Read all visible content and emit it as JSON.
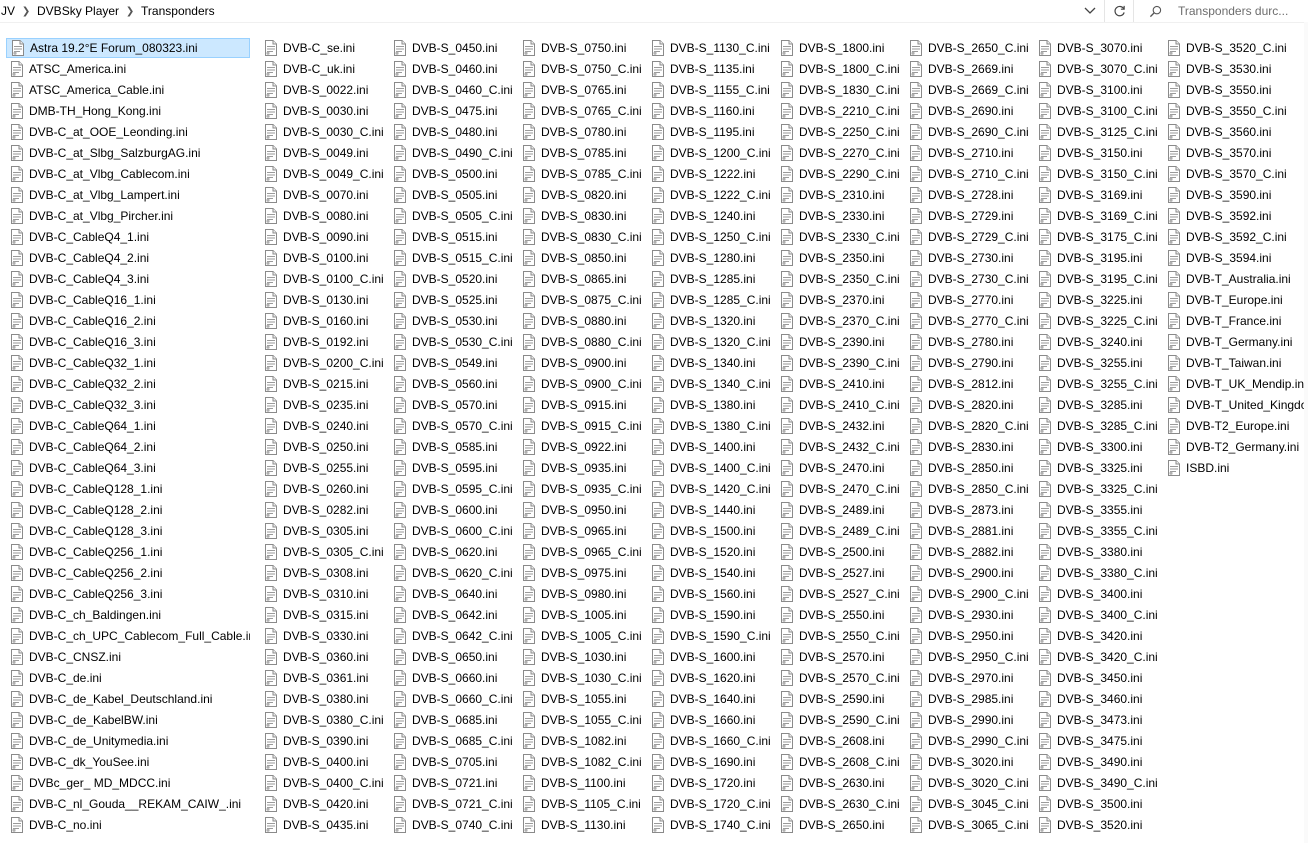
{
  "breadcrumb": {
    "items": [
      "JV",
      "DVBSky Player",
      "Transponders"
    ]
  },
  "search": {
    "placeholder": "Transponders durc..."
  },
  "colors": {
    "selection_bg": "#cce8ff",
    "selection_border": "#99d1ff"
  },
  "selected_file": "Astra 19.2°E Forum_080323.ini",
  "files": [
    [
      "Astra 19.2°E Forum_080323.ini",
      "ATSC_America.ini",
      "ATSC_America_Cable.ini",
      "DMB-TH_Hong_Kong.ini",
      "DVB-C_at_OOE_Leonding.ini",
      "DVB-C_at_Slbg_SalzburgAG.ini",
      "DVB-C_at_Vlbg_Cablecom.ini",
      "DVB-C_at_Vlbg_Lampert.ini",
      "DVB-C_at_Vlbg_Pircher.ini",
      "DVB-C_CableQ4_1.ini",
      "DVB-C_CableQ4_2.ini",
      "DVB-C_CableQ4_3.ini",
      "DVB-C_CableQ16_1.ini",
      "DVB-C_CableQ16_2.ini",
      "DVB-C_CableQ16_3.ini",
      "DVB-C_CableQ32_1.ini",
      "DVB-C_CableQ32_2.ini",
      "DVB-C_CableQ32_3.ini",
      "DVB-C_CableQ64_1.ini",
      "DVB-C_CableQ64_2.ini",
      "DVB-C_CableQ64_3.ini",
      "DVB-C_CableQ128_1.ini",
      "DVB-C_CableQ128_2.ini",
      "DVB-C_CableQ128_3.ini",
      "DVB-C_CableQ256_1.ini",
      "DVB-C_CableQ256_2.ini",
      "DVB-C_CableQ256_3.ini",
      "DVB-C_ch_Baldingen.ini",
      "DVB-C_ch_UPC_Cablecom_Full_Cable.ini",
      "DVB-C_CNSZ.ini",
      "DVB-C_de.ini",
      "DVB-C_de_Kabel_Deutschland.ini",
      "DVB-C_de_KabelBW.ini",
      "DVB-C_de_Unitymedia.ini",
      "DVB-C_dk_YouSee.ini",
      "DVBc_ger_ MD_MDCC.ini",
      "DVB-C_nl_Gouda__REKAM_CAIW_.ini",
      "DVB-C_no.ini"
    ],
    [
      "DVB-C_se.ini",
      "DVB-C_uk.ini",
      "DVB-S_0022.ini",
      "DVB-S_0030.ini",
      "DVB-S_0030_C.ini",
      "DVB-S_0049.ini",
      "DVB-S_0049_C.ini",
      "DVB-S_0070.ini",
      "DVB-S_0080.ini",
      "DVB-S_0090.ini",
      "DVB-S_0100.ini",
      "DVB-S_0100_C.ini",
      "DVB-S_0130.ini",
      "DVB-S_0160.ini",
      "DVB-S_0192.ini",
      "DVB-S_0200_C.ini",
      "DVB-S_0215.ini",
      "DVB-S_0235.ini",
      "DVB-S_0240.ini",
      "DVB-S_0250.ini",
      "DVB-S_0255.ini",
      "DVB-S_0260.ini",
      "DVB-S_0282.ini",
      "DVB-S_0305.ini",
      "DVB-S_0305_C.ini",
      "DVB-S_0308.ini",
      "DVB-S_0310.ini",
      "DVB-S_0315.ini",
      "DVB-S_0330.ini",
      "DVB-S_0360.ini",
      "DVB-S_0361.ini",
      "DVB-S_0380.ini",
      "DVB-S_0380_C.ini",
      "DVB-S_0390.ini",
      "DVB-S_0400.ini",
      "DVB-S_0400_C.ini",
      "DVB-S_0420.ini",
      "DVB-S_0435.ini"
    ],
    [
      "DVB-S_0450.ini",
      "DVB-S_0460.ini",
      "DVB-S_0460_C.ini",
      "DVB-S_0475.ini",
      "DVB-S_0480.ini",
      "DVB-S_0490_C.ini",
      "DVB-S_0500.ini",
      "DVB-S_0505.ini",
      "DVB-S_0505_C.ini",
      "DVB-S_0515.ini",
      "DVB-S_0515_C.ini",
      "DVB-S_0520.ini",
      "DVB-S_0525.ini",
      "DVB-S_0530.ini",
      "DVB-S_0530_C.ini",
      "DVB-S_0549.ini",
      "DVB-S_0560.ini",
      "DVB-S_0570.ini",
      "DVB-S_0570_C.ini",
      "DVB-S_0585.ini",
      "DVB-S_0595.ini",
      "DVB-S_0595_C.ini",
      "DVB-S_0600.ini",
      "DVB-S_0600_C.ini",
      "DVB-S_0620.ini",
      "DVB-S_0620_C.ini",
      "DVB-S_0640.ini",
      "DVB-S_0642.ini",
      "DVB-S_0642_C.ini",
      "DVB-S_0650.ini",
      "DVB-S_0660.ini",
      "DVB-S_0660_C.ini",
      "DVB-S_0685.ini",
      "DVB-S_0685_C.ini",
      "DVB-S_0705.ini",
      "DVB-S_0721.ini",
      "DVB-S_0721_C.ini",
      "DVB-S_0740_C.ini"
    ],
    [
      "DVB-S_0750.ini",
      "DVB-S_0750_C.ini",
      "DVB-S_0765.ini",
      "DVB-S_0765_C.ini",
      "DVB-S_0780.ini",
      "DVB-S_0785.ini",
      "DVB-S_0785_C.ini",
      "DVB-S_0820.ini",
      "DVB-S_0830.ini",
      "DVB-S_0830_C.ini",
      "DVB-S_0850.ini",
      "DVB-S_0865.ini",
      "DVB-S_0875_C.ini",
      "DVB-S_0880.ini",
      "DVB-S_0880_C.ini",
      "DVB-S_0900.ini",
      "DVB-S_0900_C.ini",
      "DVB-S_0915.ini",
      "DVB-S_0915_C.ini",
      "DVB-S_0922.ini",
      "DVB-S_0935.ini",
      "DVB-S_0935_C.ini",
      "DVB-S_0950.ini",
      "DVB-S_0965.ini",
      "DVB-S_0965_C.ini",
      "DVB-S_0975.ini",
      "DVB-S_0980.ini",
      "DVB-S_1005.ini",
      "DVB-S_1005_C.ini",
      "DVB-S_1030.ini",
      "DVB-S_1030_C.ini",
      "DVB-S_1055.ini",
      "DVB-S_1055_C.ini",
      "DVB-S_1082.ini",
      "DVB-S_1082_C.ini",
      "DVB-S_1100.ini",
      "DVB-S_1105_C.ini",
      "DVB-S_1130.ini"
    ],
    [
      "DVB-S_1130_C.ini",
      "DVB-S_1135.ini",
      "DVB-S_1155_C.ini",
      "DVB-S_1160.ini",
      "DVB-S_1195.ini",
      "DVB-S_1200_C.ini",
      "DVB-S_1222.ini",
      "DVB-S_1222_C.ini",
      "DVB-S_1240.ini",
      "DVB-S_1250_C.ini",
      "DVB-S_1280.ini",
      "DVB-S_1285.ini",
      "DVB-S_1285_C.ini",
      "DVB-S_1320.ini",
      "DVB-S_1320_C.ini",
      "DVB-S_1340.ini",
      "DVB-S_1340_C.ini",
      "DVB-S_1380.ini",
      "DVB-S_1380_C.ini",
      "DVB-S_1400.ini",
      "DVB-S_1400_C.ini",
      "DVB-S_1420_C.ini",
      "DVB-S_1440.ini",
      "DVB-S_1500.ini",
      "DVB-S_1520.ini",
      "DVB-S_1540.ini",
      "DVB-S_1560.ini",
      "DVB-S_1590.ini",
      "DVB-S_1590_C.ini",
      "DVB-S_1600.ini",
      "DVB-S_1620.ini",
      "DVB-S_1640.ini",
      "DVB-S_1660.ini",
      "DVB-S_1660_C.ini",
      "DVB-S_1690.ini",
      "DVB-S_1720.ini",
      "DVB-S_1720_C.ini",
      "DVB-S_1740_C.ini"
    ],
    [
      "DVB-S_1800.ini",
      "DVB-S_1800_C.ini",
      "DVB-S_1830_C.ini",
      "DVB-S_2210_C.ini",
      "DVB-S_2250_C.ini",
      "DVB-S_2270_C.ini",
      "DVB-S_2290_C.ini",
      "DVB-S_2310.ini",
      "DVB-S_2330.ini",
      "DVB-S_2330_C.ini",
      "DVB-S_2350.ini",
      "DVB-S_2350_C.ini",
      "DVB-S_2370.ini",
      "DVB-S_2370_C.ini",
      "DVB-S_2390.ini",
      "DVB-S_2390_C.ini",
      "DVB-S_2410.ini",
      "DVB-S_2410_C.ini",
      "DVB-S_2432.ini",
      "DVB-S_2432_C.ini",
      "DVB-S_2470.ini",
      "DVB-S_2470_C.ini",
      "DVB-S_2489.ini",
      "DVB-S_2489_C.ini",
      "DVB-S_2500.ini",
      "DVB-S_2527.ini",
      "DVB-S_2527_C.ini",
      "DVB-S_2550.ini",
      "DVB-S_2550_C.ini",
      "DVB-S_2570.ini",
      "DVB-S_2570_C.ini",
      "DVB-S_2590.ini",
      "DVB-S_2590_C.ini",
      "DVB-S_2608.ini",
      "DVB-S_2608_C.ini",
      "DVB-S_2630.ini",
      "DVB-S_2630_C.ini",
      "DVB-S_2650.ini"
    ],
    [
      "DVB-S_2650_C.ini",
      "DVB-S_2669.ini",
      "DVB-S_2669_C.ini",
      "DVB-S_2690.ini",
      "DVB-S_2690_C.ini",
      "DVB-S_2710.ini",
      "DVB-S_2710_C.ini",
      "DVB-S_2728.ini",
      "DVB-S_2729.ini",
      "DVB-S_2729_C.ini",
      "DVB-S_2730.ini",
      "DVB-S_2730_C.ini",
      "DVB-S_2770.ini",
      "DVB-S_2770_C.ini",
      "DVB-S_2780.ini",
      "DVB-S_2790.ini",
      "DVB-S_2812.ini",
      "DVB-S_2820.ini",
      "DVB-S_2820_C.ini",
      "DVB-S_2830.ini",
      "DVB-S_2850.ini",
      "DVB-S_2850_C.ini",
      "DVB-S_2873.ini",
      "DVB-S_2881.ini",
      "DVB-S_2882.ini",
      "DVB-S_2900.ini",
      "DVB-S_2900_C.ini",
      "DVB-S_2930.ini",
      "DVB-S_2950.ini",
      "DVB-S_2950_C.ini",
      "DVB-S_2970.ini",
      "DVB-S_2985.ini",
      "DVB-S_2990.ini",
      "DVB-S_2990_C.ini",
      "DVB-S_3020.ini",
      "DVB-S_3020_C.ini",
      "DVB-S_3045_C.ini",
      "DVB-S_3065_C.ini"
    ],
    [
      "DVB-S_3070.ini",
      "DVB-S_3070_C.ini",
      "DVB-S_3100.ini",
      "DVB-S_3100_C.ini",
      "DVB-S_3125_C.ini",
      "DVB-S_3150.ini",
      "DVB-S_3150_C.ini",
      "DVB-S_3169.ini",
      "DVB-S_3169_C.ini",
      "DVB-S_3175_C.ini",
      "DVB-S_3195.ini",
      "DVB-S_3195_C.ini",
      "DVB-S_3225.ini",
      "DVB-S_3225_C.ini",
      "DVB-S_3240.ini",
      "DVB-S_3255.ini",
      "DVB-S_3255_C.ini",
      "DVB-S_3285.ini",
      "DVB-S_3285_C.ini",
      "DVB-S_3300.ini",
      "DVB-S_3325.ini",
      "DVB-S_3325_C.ini",
      "DVB-S_3355.ini",
      "DVB-S_3355_C.ini",
      "DVB-S_3380.ini",
      "DVB-S_3380_C.ini",
      "DVB-S_3400.ini",
      "DVB-S_3400_C.ini",
      "DVB-S_3420.ini",
      "DVB-S_3420_C.ini",
      "DVB-S_3450.ini",
      "DVB-S_3460.ini",
      "DVB-S_3473.ini",
      "DVB-S_3475.ini",
      "DVB-S_3490.ini",
      "DVB-S_3490_C.ini",
      "DVB-S_3500.ini",
      "DVB-S_3520.ini"
    ],
    [
      "DVB-S_3520_C.ini",
      "DVB-S_3530.ini",
      "DVB-S_3550.ini",
      "DVB-S_3550_C.ini",
      "DVB-S_3560.ini",
      "DVB-S_3570.ini",
      "DVB-S_3570_C.ini",
      "DVB-S_3590.ini",
      "DVB-S_3592.ini",
      "DVB-S_3592_C.ini",
      "DVB-S_3594.ini",
      "DVB-T_Australia.ini",
      "DVB-T_Europe.ini",
      "DVB-T_France.ini",
      "DVB-T_Germany.ini",
      "DVB-T_Taiwan.ini",
      "DVB-T_UK_Mendip.ini",
      "DVB-T_United_Kingdom.ini",
      "DVB-T2_Europe.ini",
      "DVB-T2_Germany.ini",
      "ISBD.ini"
    ]
  ]
}
